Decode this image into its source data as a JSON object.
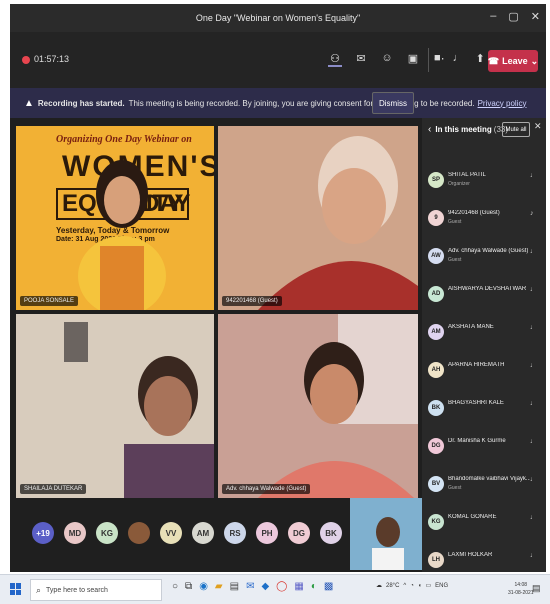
{
  "window": {
    "title": "One Day \"Webinar on Women's Equality\""
  },
  "toolbar": {
    "timer": "01:57:13",
    "leave_label": "Leave"
  },
  "banner": {
    "title": "Recording has started.",
    "message": "This meeting is being recorded. By joining, you are giving consent for this meeting to be recorded.",
    "link": "Privacy policy",
    "dismiss_label": "Dismiss"
  },
  "poster": {
    "line1": "Organizing One Day Webinar on",
    "big1": "WOMEN'S",
    "equality": "EQUALITY",
    "day": "DAY",
    "line2": "Yesterday, Today & Tomorrow",
    "line3": "Date: 31 Aug 2021 Time: 3 pm"
  },
  "tiles": [
    {
      "name": "POOJA SONSALE"
    },
    {
      "name": "942201468 (Guest)"
    },
    {
      "name": "SHAILAJA DUTEKAR"
    },
    {
      "name": "Adv. chhaya Walwade (Guest)"
    }
  ],
  "strip": {
    "avatars": [
      "+19",
      "MD",
      "KG",
      "",
      "VV",
      "AM",
      "RS",
      "PH",
      "DG",
      "BK"
    ]
  },
  "panel": {
    "title": "In this meeting",
    "count": "(33)",
    "mute_all": "Mute all",
    "participants": [
      {
        "initials": "SP",
        "name": "SHITAL PATIL",
        "role": "Organizer"
      },
      {
        "initials": "9",
        "name": "942201468 (Guest)",
        "role": "Guest"
      },
      {
        "initials": "AW",
        "name": "Adv. chhaya Walwade (Guest)",
        "role": "Guest"
      },
      {
        "initials": "AD",
        "name": "AISHWARYA DEVSHATWAR",
        "role": ""
      },
      {
        "initials": "AM",
        "name": "AKSHATA MANE",
        "role": ""
      },
      {
        "initials": "AH",
        "name": "APARNA HIREMATH",
        "role": ""
      },
      {
        "initials": "BK",
        "name": "BHAGYASHRI KALE",
        "role": ""
      },
      {
        "initials": "DG",
        "name": "Dr. Manisha K Gurme",
        "role": ""
      },
      {
        "initials": "BV",
        "name": "Bhandomalke vaibhavi Vijayk...",
        "role": "Guest"
      },
      {
        "initials": "KG",
        "name": "KOMAL GONARE",
        "role": ""
      },
      {
        "initials": "LH",
        "name": "LAXMI HOLKAR",
        "role": ""
      }
    ]
  },
  "taskbar": {
    "search_placeholder": "Type here to search",
    "weather": "28°C",
    "lang": "ENG",
    "time": "14:08",
    "date": "31-08-2021"
  }
}
